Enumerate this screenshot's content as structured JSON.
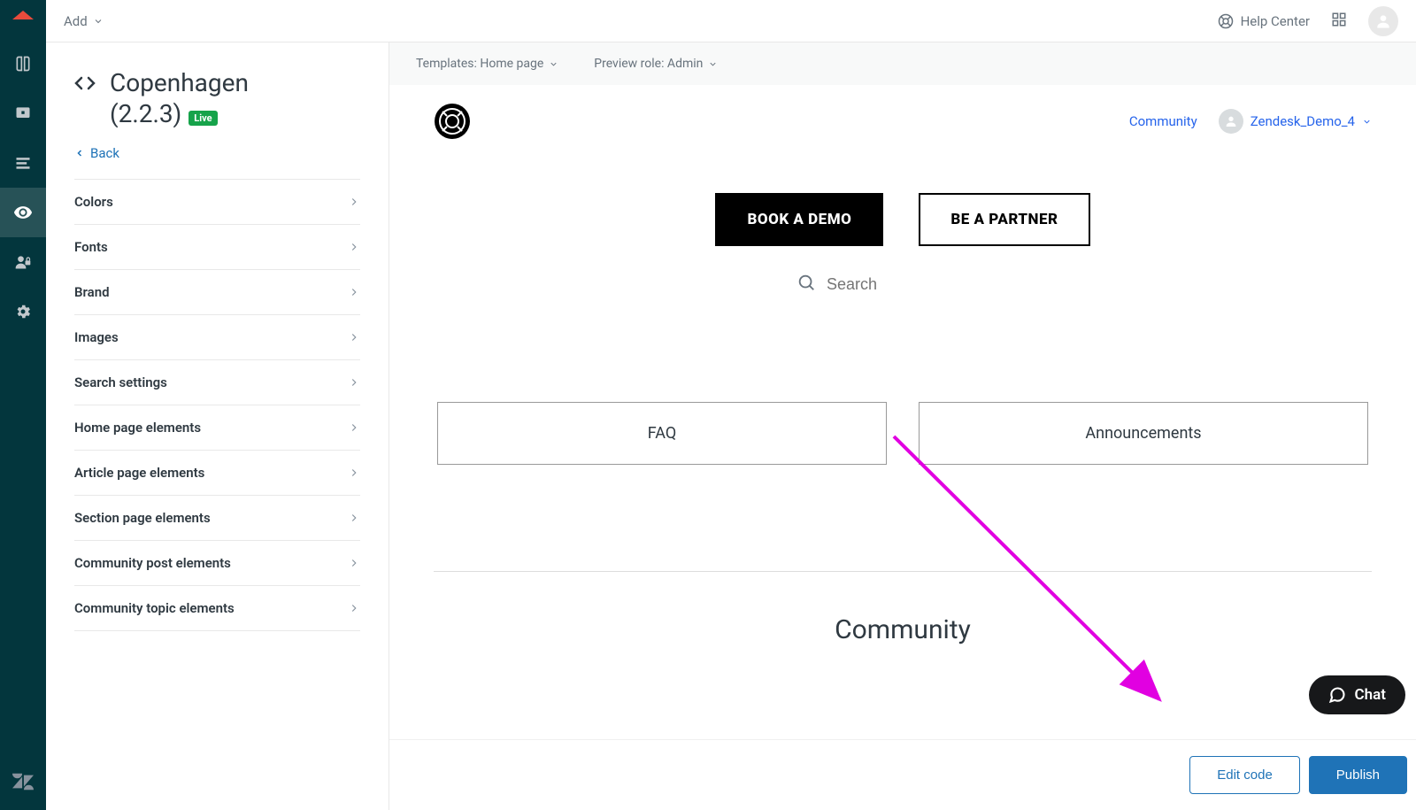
{
  "topbar": {
    "add_label": "Add",
    "help_center_label": "Help Center"
  },
  "sidebar": {
    "theme_name": "Copenhagen",
    "theme_version": "(2.2.3)",
    "live_badge": "Live",
    "back_label": "Back",
    "items": [
      "Colors",
      "Fonts",
      "Brand",
      "Images",
      "Search settings",
      "Home page elements",
      "Article page elements",
      "Section page elements",
      "Community post elements",
      "Community topic elements"
    ]
  },
  "preview_header": {
    "templates_label": "Templates: Home page",
    "role_label": "Preview role: Admin"
  },
  "preview": {
    "community_link": "Community",
    "user_name": "Zendesk_Demo_4",
    "hero": {
      "book_demo": "BOOK A DEMO",
      "be_partner": "BE A PARTNER"
    },
    "search_placeholder": "Search",
    "categories": [
      "FAQ",
      "Announcements"
    ],
    "community_heading": "Community"
  },
  "footer": {
    "edit_code": "Edit code",
    "publish": "Publish"
  },
  "chat": {
    "label": "Chat"
  },
  "colors": {
    "rail_bg": "#03363d",
    "primary_link": "#1f73b7",
    "publish_bg": "#1f73b7",
    "live_badge_bg": "#16a34a",
    "arrow": "#e100e1"
  }
}
